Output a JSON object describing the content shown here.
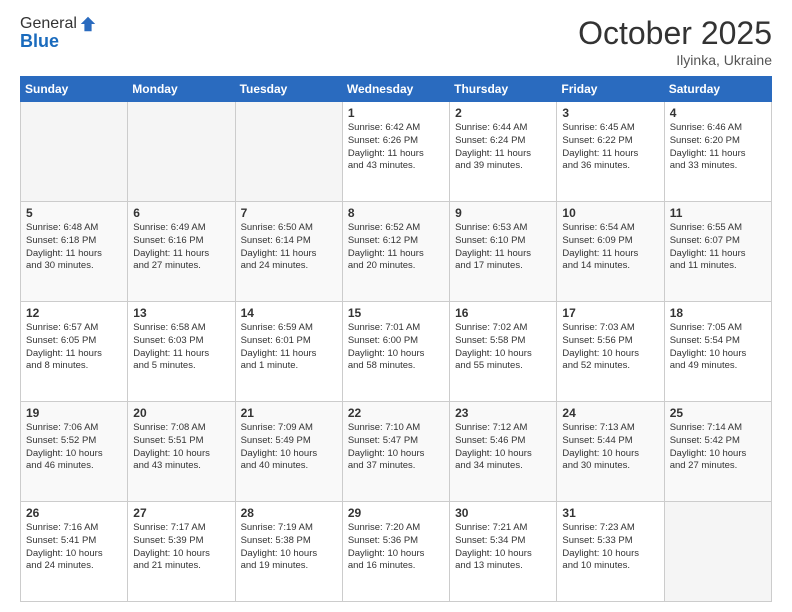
{
  "header": {
    "logo_line1": "General",
    "logo_line2": "Blue",
    "month": "October 2025",
    "location": "Ilyinka, Ukraine"
  },
  "weekdays": [
    "Sunday",
    "Monday",
    "Tuesday",
    "Wednesday",
    "Thursday",
    "Friday",
    "Saturday"
  ],
  "weeks": [
    [
      {
        "day": "",
        "info": ""
      },
      {
        "day": "",
        "info": ""
      },
      {
        "day": "",
        "info": ""
      },
      {
        "day": "1",
        "info": "Sunrise: 6:42 AM\nSunset: 6:26 PM\nDaylight: 11 hours\nand 43 minutes."
      },
      {
        "day": "2",
        "info": "Sunrise: 6:44 AM\nSunset: 6:24 PM\nDaylight: 11 hours\nand 39 minutes."
      },
      {
        "day": "3",
        "info": "Sunrise: 6:45 AM\nSunset: 6:22 PM\nDaylight: 11 hours\nand 36 minutes."
      },
      {
        "day": "4",
        "info": "Sunrise: 6:46 AM\nSunset: 6:20 PM\nDaylight: 11 hours\nand 33 minutes."
      }
    ],
    [
      {
        "day": "5",
        "info": "Sunrise: 6:48 AM\nSunset: 6:18 PM\nDaylight: 11 hours\nand 30 minutes."
      },
      {
        "day": "6",
        "info": "Sunrise: 6:49 AM\nSunset: 6:16 PM\nDaylight: 11 hours\nand 27 minutes."
      },
      {
        "day": "7",
        "info": "Sunrise: 6:50 AM\nSunset: 6:14 PM\nDaylight: 11 hours\nand 24 minutes."
      },
      {
        "day": "8",
        "info": "Sunrise: 6:52 AM\nSunset: 6:12 PM\nDaylight: 11 hours\nand 20 minutes."
      },
      {
        "day": "9",
        "info": "Sunrise: 6:53 AM\nSunset: 6:10 PM\nDaylight: 11 hours\nand 17 minutes."
      },
      {
        "day": "10",
        "info": "Sunrise: 6:54 AM\nSunset: 6:09 PM\nDaylight: 11 hours\nand 14 minutes."
      },
      {
        "day": "11",
        "info": "Sunrise: 6:55 AM\nSunset: 6:07 PM\nDaylight: 11 hours\nand 11 minutes."
      }
    ],
    [
      {
        "day": "12",
        "info": "Sunrise: 6:57 AM\nSunset: 6:05 PM\nDaylight: 11 hours\nand 8 minutes."
      },
      {
        "day": "13",
        "info": "Sunrise: 6:58 AM\nSunset: 6:03 PM\nDaylight: 11 hours\nand 5 minutes."
      },
      {
        "day": "14",
        "info": "Sunrise: 6:59 AM\nSunset: 6:01 PM\nDaylight: 11 hours\nand 1 minute."
      },
      {
        "day": "15",
        "info": "Sunrise: 7:01 AM\nSunset: 6:00 PM\nDaylight: 10 hours\nand 58 minutes."
      },
      {
        "day": "16",
        "info": "Sunrise: 7:02 AM\nSunset: 5:58 PM\nDaylight: 10 hours\nand 55 minutes."
      },
      {
        "day": "17",
        "info": "Sunrise: 7:03 AM\nSunset: 5:56 PM\nDaylight: 10 hours\nand 52 minutes."
      },
      {
        "day": "18",
        "info": "Sunrise: 7:05 AM\nSunset: 5:54 PM\nDaylight: 10 hours\nand 49 minutes."
      }
    ],
    [
      {
        "day": "19",
        "info": "Sunrise: 7:06 AM\nSunset: 5:52 PM\nDaylight: 10 hours\nand 46 minutes."
      },
      {
        "day": "20",
        "info": "Sunrise: 7:08 AM\nSunset: 5:51 PM\nDaylight: 10 hours\nand 43 minutes."
      },
      {
        "day": "21",
        "info": "Sunrise: 7:09 AM\nSunset: 5:49 PM\nDaylight: 10 hours\nand 40 minutes."
      },
      {
        "day": "22",
        "info": "Sunrise: 7:10 AM\nSunset: 5:47 PM\nDaylight: 10 hours\nand 37 minutes."
      },
      {
        "day": "23",
        "info": "Sunrise: 7:12 AM\nSunset: 5:46 PM\nDaylight: 10 hours\nand 34 minutes."
      },
      {
        "day": "24",
        "info": "Sunrise: 7:13 AM\nSunset: 5:44 PM\nDaylight: 10 hours\nand 30 minutes."
      },
      {
        "day": "25",
        "info": "Sunrise: 7:14 AM\nSunset: 5:42 PM\nDaylight: 10 hours\nand 27 minutes."
      }
    ],
    [
      {
        "day": "26",
        "info": "Sunrise: 7:16 AM\nSunset: 5:41 PM\nDaylight: 10 hours\nand 24 minutes."
      },
      {
        "day": "27",
        "info": "Sunrise: 7:17 AM\nSunset: 5:39 PM\nDaylight: 10 hours\nand 21 minutes."
      },
      {
        "day": "28",
        "info": "Sunrise: 7:19 AM\nSunset: 5:38 PM\nDaylight: 10 hours\nand 19 minutes."
      },
      {
        "day": "29",
        "info": "Sunrise: 7:20 AM\nSunset: 5:36 PM\nDaylight: 10 hours\nand 16 minutes."
      },
      {
        "day": "30",
        "info": "Sunrise: 7:21 AM\nSunset: 5:34 PM\nDaylight: 10 hours\nand 13 minutes."
      },
      {
        "day": "31",
        "info": "Sunrise: 7:23 AM\nSunset: 5:33 PM\nDaylight: 10 hours\nand 10 minutes."
      },
      {
        "day": "",
        "info": ""
      }
    ]
  ]
}
